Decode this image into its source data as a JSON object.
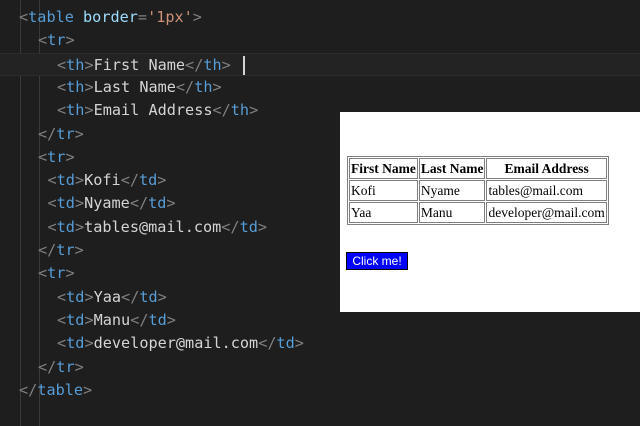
{
  "editor": {
    "colors": {
      "background": "#1e1e1e",
      "tag": "#569cd6",
      "attr": "#9cdcfe",
      "string": "#ce9178",
      "text": "#d4d4d4",
      "punct": "#808080"
    },
    "lines": [
      {
        "indent": 1,
        "tokens": [
          [
            "p",
            "<"
          ],
          [
            "t",
            "table"
          ],
          [
            "x",
            " "
          ],
          [
            "a",
            "border"
          ],
          [
            "p",
            "="
          ],
          [
            "s",
            "'1px'"
          ],
          [
            "p",
            ">"
          ]
        ]
      },
      {
        "indent": 2,
        "tokens": [
          [
            "p",
            "<"
          ],
          [
            "t",
            "tr"
          ],
          [
            "p",
            ">"
          ]
        ]
      },
      {
        "indent": 3,
        "active": true,
        "caret": true,
        "tokens": [
          [
            "p",
            "<"
          ],
          [
            "t",
            "th"
          ],
          [
            "p",
            ">"
          ],
          [
            "x",
            "First Name"
          ],
          [
            "p",
            "</"
          ],
          [
            "t",
            "th"
          ],
          [
            "p",
            ">"
          ]
        ]
      },
      {
        "indent": 3,
        "tokens": [
          [
            "p",
            "<"
          ],
          [
            "t",
            "th"
          ],
          [
            "p",
            ">"
          ],
          [
            "x",
            "Last Name"
          ],
          [
            "p",
            "</"
          ],
          [
            "t",
            "th"
          ],
          [
            "p",
            ">"
          ]
        ]
      },
      {
        "indent": 3,
        "tokens": [
          [
            "p",
            "<"
          ],
          [
            "t",
            "th"
          ],
          [
            "p",
            ">"
          ],
          [
            "x",
            "Email Address"
          ],
          [
            "p",
            "</"
          ],
          [
            "t",
            "th"
          ],
          [
            "p",
            ">"
          ]
        ]
      },
      {
        "indent": 2,
        "tokens": [
          [
            "p",
            "</"
          ],
          [
            "t",
            "tr"
          ],
          [
            "p",
            ">"
          ]
        ]
      },
      {
        "indent": 2,
        "tokens": [
          [
            "p",
            "<"
          ],
          [
            "t",
            "tr"
          ],
          [
            "p",
            ">"
          ]
        ]
      },
      {
        "indent": 2.5,
        "tokens": [
          [
            "p",
            "<"
          ],
          [
            "t",
            "td"
          ],
          [
            "p",
            ">"
          ],
          [
            "x",
            "Kofi"
          ],
          [
            "p",
            "</"
          ],
          [
            "t",
            "td"
          ],
          [
            "p",
            ">"
          ]
        ]
      },
      {
        "indent": 2.5,
        "tokens": [
          [
            "p",
            "<"
          ],
          [
            "t",
            "td"
          ],
          [
            "p",
            ">"
          ],
          [
            "x",
            "Nyame"
          ],
          [
            "p",
            "</"
          ],
          [
            "t",
            "td"
          ],
          [
            "p",
            ">"
          ]
        ]
      },
      {
        "indent": 2.5,
        "tokens": [
          [
            "p",
            "<"
          ],
          [
            "t",
            "td"
          ],
          [
            "p",
            ">"
          ],
          [
            "x",
            "tables@mail.com"
          ],
          [
            "p",
            "</"
          ],
          [
            "t",
            "td"
          ],
          [
            "p",
            ">"
          ]
        ]
      },
      {
        "indent": 2,
        "tokens": [
          [
            "p",
            "</"
          ],
          [
            "t",
            "tr"
          ],
          [
            "p",
            ">"
          ]
        ]
      },
      {
        "indent": 2,
        "tokens": [
          [
            "p",
            "<"
          ],
          [
            "t",
            "tr"
          ],
          [
            "p",
            ">"
          ]
        ]
      },
      {
        "indent": 3,
        "tokens": [
          [
            "p",
            "<"
          ],
          [
            "t",
            "td"
          ],
          [
            "p",
            ">"
          ],
          [
            "x",
            "Yaa"
          ],
          [
            "p",
            "</"
          ],
          [
            "t",
            "td"
          ],
          [
            "p",
            ">"
          ]
        ]
      },
      {
        "indent": 3,
        "tokens": [
          [
            "p",
            "<"
          ],
          [
            "t",
            "td"
          ],
          [
            "p",
            ">"
          ],
          [
            "x",
            "Manu"
          ],
          [
            "p",
            "</"
          ],
          [
            "t",
            "td"
          ],
          [
            "p",
            ">"
          ]
        ]
      },
      {
        "indent": 3,
        "tokens": [
          [
            "p",
            "<"
          ],
          [
            "t",
            "td"
          ],
          [
            "p",
            ">"
          ],
          [
            "x",
            "developer@mail.com"
          ],
          [
            "p",
            "</"
          ],
          [
            "t",
            "td"
          ],
          [
            "p",
            ">"
          ]
        ]
      },
      {
        "indent": 2,
        "tokens": [
          [
            "p",
            "</"
          ],
          [
            "t",
            "tr"
          ],
          [
            "p",
            ">"
          ]
        ]
      },
      {
        "indent": 1,
        "tokens": [
          [
            "p",
            "</"
          ],
          [
            "t",
            "table"
          ],
          [
            "p",
            ">"
          ]
        ]
      }
    ]
  },
  "preview": {
    "table": {
      "headers": [
        "First Name",
        "Last Name",
        "Email Address"
      ],
      "rows": [
        [
          "Kofi",
          "Nyame",
          "tables@mail.com"
        ],
        [
          "Yaa",
          "Manu",
          "developer@mail.com"
        ]
      ]
    },
    "button": {
      "label": "Click me!",
      "background": "#0000ff",
      "color": "#ffffff"
    }
  }
}
